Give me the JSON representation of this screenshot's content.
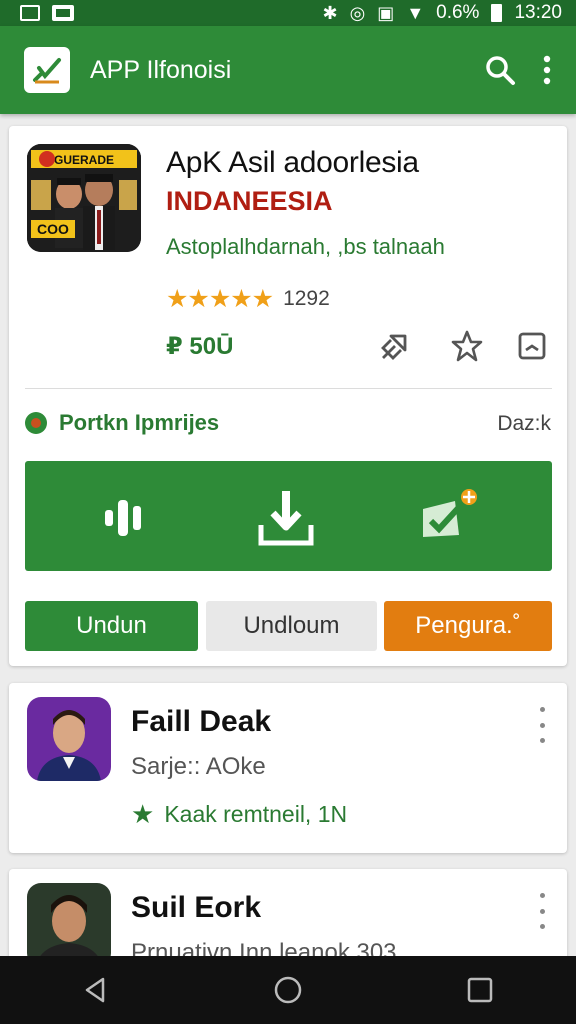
{
  "status_bar": {
    "battery_text": "0.6%",
    "time": "13:20",
    "icons": [
      "photo-icon",
      "gallery-icon",
      "bluetooth-icon",
      "alarm-icon",
      "nfc-icon",
      "wifi-icon",
      "battery-icon"
    ]
  },
  "app_bar": {
    "title": "APP Ilfonoisi",
    "icons": [
      "search-icon",
      "more-vert-icon"
    ]
  },
  "app_detail": {
    "name": "ApK Asil adoorlesia",
    "subtitle": "INDANEESIA",
    "developer": "Astoplalhdarnah, ,bs  talnaah",
    "stars": "★★★★★",
    "rating_count": "1292",
    "price": "₽ 50Ū",
    "icon_badge_text": "GUERADE",
    "icon_bottom_text": "COO",
    "actions": [
      "share-icon",
      "star-outline-icon",
      "bookmark-icon"
    ],
    "permissions_label": "Portkn Ipmrijes",
    "permissions_right": "Daz:k",
    "buttons": {
      "primary": "Undun",
      "secondary": "Undloum",
      "tertiary": "Pengura.˚"
    }
  },
  "list": [
    {
      "name": "Faill Deak",
      "subtitle": "Sarje:: AOke",
      "meta_star": "★",
      "meta": "Kaak remtneil, 1N"
    },
    {
      "name": "Suil Eork",
      "subtitle": "Prnuativn Inn leanok 303",
      "meta": ""
    }
  ],
  "colors": {
    "status_bar": "#1f6b2a",
    "app_bar": "#2e8b38",
    "accent_red": "#b01e12",
    "accent_orange": "#e27d10",
    "star": "#f0a019"
  }
}
